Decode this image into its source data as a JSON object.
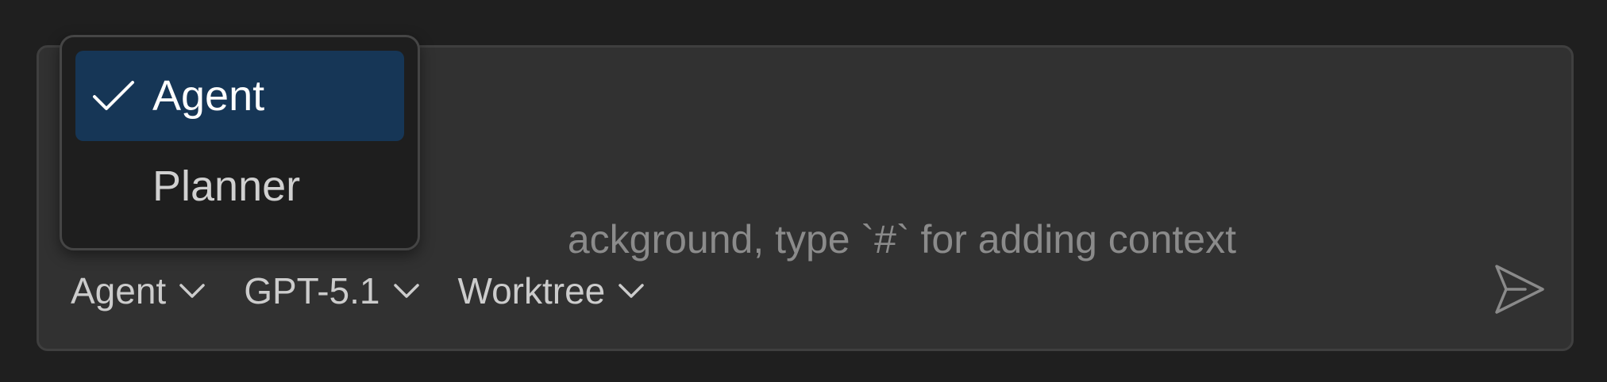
{
  "composer": {
    "placeholder_visible": "ackground, type `#` for adding context"
  },
  "toolbar": {
    "mode_label": "Agent",
    "model_label": "GPT-5.1",
    "workspace_label": "Worktree"
  },
  "mode_menu": {
    "items": [
      {
        "label": "Agent",
        "selected": true
      },
      {
        "label": "Planner",
        "selected": false
      }
    ]
  },
  "icons": {
    "chevron": "chevron-down-icon",
    "check": "check-icon",
    "send": "send-icon"
  },
  "colors": {
    "background": "#1f1f1f",
    "panel": "#313131",
    "menu_background": "#1e1e1e",
    "selected_item": "#163656",
    "placeholder_text": "#8b8b8b",
    "toolbar_text": "#cccccc"
  }
}
